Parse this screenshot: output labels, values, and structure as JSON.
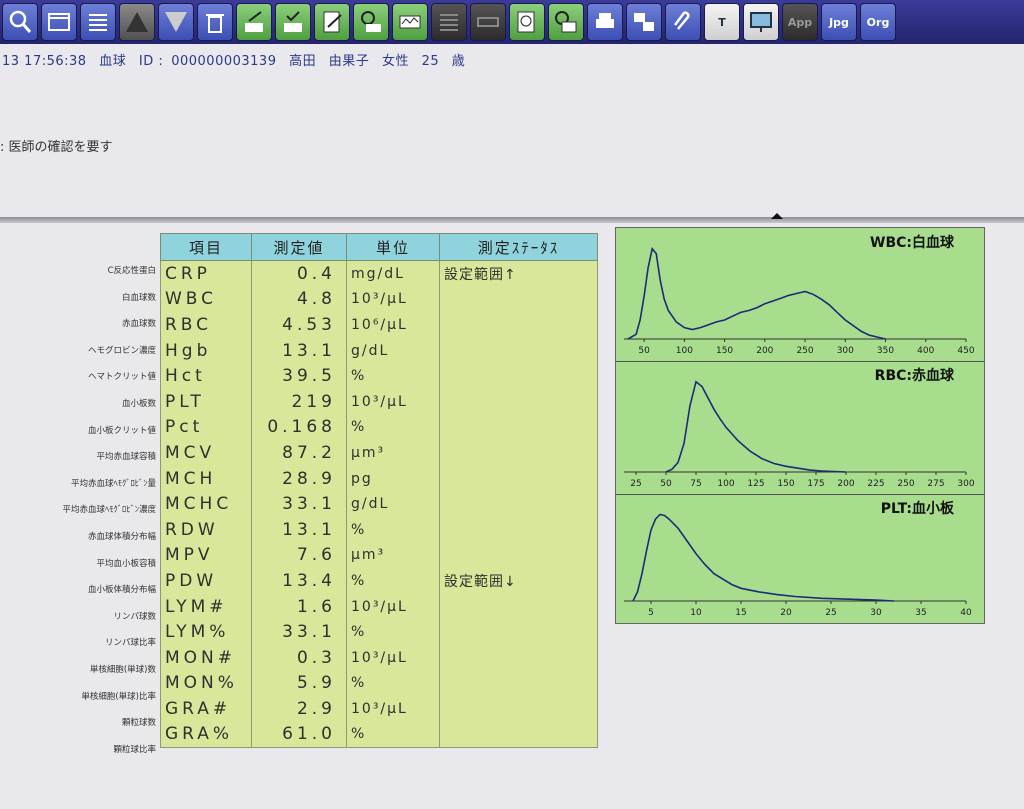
{
  "toolbar": {
    "buttons": [
      {
        "icon": "magnifier-icon",
        "style": "tb-blue"
      },
      {
        "icon": "screen-icon",
        "style": "tb-blue"
      },
      {
        "icon": "list-icon",
        "style": "tb-blue"
      },
      {
        "icon": "arrow-up-icon",
        "style": "tb-gray"
      },
      {
        "icon": "arrow-down-icon",
        "style": "tb-blue"
      },
      {
        "icon": "trash-icon",
        "style": "tb-blue"
      },
      {
        "icon": "pen-qr-icon",
        "style": "tb-green"
      },
      {
        "icon": "check-qr-icon",
        "style": "tb-green"
      },
      {
        "icon": "edit-doc-icon",
        "style": "tb-green"
      },
      {
        "icon": "clock-qr-icon",
        "style": "tb-green"
      },
      {
        "icon": "graph-icon",
        "style": "tb-green"
      },
      {
        "icon": "rows-icon",
        "style": "tb-dark"
      },
      {
        "icon": "ruler-icon",
        "style": "tb-dark"
      },
      {
        "icon": "clock-doc-icon",
        "style": "tb-green"
      },
      {
        "icon": "clock-chart-icon",
        "style": "tb-green"
      },
      {
        "icon": "printer-icon",
        "style": "tb-blue"
      },
      {
        "icon": "transfer-icon",
        "style": "tb-blue"
      },
      {
        "icon": "clip-icon",
        "style": "tb-blue"
      },
      {
        "icon": "text-icon",
        "style": "tb-white",
        "label": "T"
      },
      {
        "icon": "monitor-icon",
        "style": "tb-white"
      },
      {
        "icon": "app-icon",
        "style": "tb-dark",
        "label": "App"
      },
      {
        "icon": "jpg-icon",
        "style": "tb-blue",
        "label": "Jpg"
      },
      {
        "icon": "org-icon",
        "style": "tb-blue",
        "label": "Org"
      }
    ]
  },
  "patient": {
    "datetime": "13 17:56:38",
    "test_type": "血球",
    "id_label": "ID :",
    "id": "000000003139",
    "name_family": "高田",
    "name_given": "由果子",
    "sex": "女性",
    "age": "25",
    "age_unit": "歳"
  },
  "notice": ": 医師の確認を要す",
  "table": {
    "headers": [
      "項目",
      "測定値",
      "単位",
      "測定ｽﾃｰﾀｽ"
    ],
    "rows": [
      {
        "label": "C反応性蛋白",
        "item": "CRP",
        "value": "0.4",
        "unit": "mg/dL",
        "status": "設定範囲↑"
      },
      {
        "label": "白血球数",
        "item": "WBC",
        "value": "4.8",
        "unit": "10³/μL",
        "status": ""
      },
      {
        "label": "赤血球数",
        "item": "RBC",
        "value": "4.53",
        "unit": "10⁶/μL",
        "status": ""
      },
      {
        "label": "ヘモグロビン濃度",
        "item": "Hgb",
        "value": "13.1",
        "unit": "g/dL",
        "status": ""
      },
      {
        "label": "ヘマトクリット値",
        "item": "Hct",
        "value": "39.5",
        "unit": "%",
        "status": ""
      },
      {
        "label": "血小板数",
        "item": "PLT",
        "value": "219",
        "unit": "10³/μL",
        "status": ""
      },
      {
        "label": "血小板クリット値",
        "item": "Pct",
        "value": "0.168",
        "unit": "%",
        "status": ""
      },
      {
        "label": "平均赤血球容積",
        "item": "MCV",
        "value": "87.2",
        "unit": "μm³",
        "status": ""
      },
      {
        "label": "平均赤血球ﾍﾓｸﾞﾛﾋﾞﾝ量",
        "item": "MCH",
        "value": "28.9",
        "unit": "pg",
        "status": ""
      },
      {
        "label": "平均赤血球ﾍﾓｸﾞﾛﾋﾞﾝ濃度",
        "item": "MCHC",
        "value": "33.1",
        "unit": "g/dL",
        "status": ""
      },
      {
        "label": "赤血球体積分布幅",
        "item": "RDW",
        "value": "13.1",
        "unit": "%",
        "status": ""
      },
      {
        "label": "平均血小板容積",
        "item": "MPV",
        "value": "7.6",
        "unit": "μm³",
        "status": ""
      },
      {
        "label": "血小板体積分布幅",
        "item": "PDW",
        "value": "13.4",
        "unit": "%",
        "status": "設定範囲↓"
      },
      {
        "label": "リンパ球数",
        "item": "LYM#",
        "value": "1.6",
        "unit": "10³/μL",
        "status": ""
      },
      {
        "label": "リンパ球比率",
        "item": "LYM%",
        "value": "33.1",
        "unit": "%",
        "status": ""
      },
      {
        "label": "単核細胞(単球)数",
        "item": "MON#",
        "value": "0.3",
        "unit": "10³/μL",
        "status": ""
      },
      {
        "label": "単核細胞(単球)比率",
        "item": "MON%",
        "value": "5.9",
        "unit": "%",
        "status": ""
      },
      {
        "label": "顆粒球数",
        "item": "GRA#",
        "value": "2.9",
        "unit": "10³/μL",
        "status": ""
      },
      {
        "label": "顆粒球比率",
        "item": "GRA%",
        "value": "61.0",
        "unit": "%",
        "status": ""
      }
    ]
  },
  "chart_data": [
    {
      "type": "line",
      "title": "WBC:白血球",
      "xlim": [
        25,
        450
      ],
      "xticks": [
        50,
        100,
        150,
        200,
        250,
        300,
        350,
        400,
        450
      ],
      "x": [
        30,
        40,
        45,
        50,
        55,
        60,
        65,
        70,
        75,
        80,
        90,
        100,
        110,
        120,
        130,
        140,
        150,
        160,
        170,
        180,
        190,
        200,
        210,
        220,
        230,
        240,
        250,
        260,
        270,
        280,
        290,
        300,
        310,
        320,
        330,
        340,
        350
      ],
      "y": [
        0,
        0.05,
        0.2,
        0.45,
        0.75,
        0.95,
        0.9,
        0.62,
        0.42,
        0.3,
        0.18,
        0.12,
        0.1,
        0.12,
        0.15,
        0.18,
        0.2,
        0.24,
        0.28,
        0.3,
        0.33,
        0.37,
        0.4,
        0.43,
        0.46,
        0.48,
        0.5,
        0.47,
        0.42,
        0.36,
        0.28,
        0.2,
        0.14,
        0.08,
        0.04,
        0.02,
        0
      ]
    },
    {
      "type": "line",
      "title": "RBC:赤血球",
      "xlim": [
        15,
        300
      ],
      "xticks": [
        25,
        50,
        75,
        100,
        125,
        150,
        175,
        200,
        225,
        250,
        275,
        300
      ],
      "x": [
        50,
        55,
        60,
        65,
        70,
        75,
        80,
        85,
        90,
        95,
        100,
        110,
        120,
        130,
        140,
        150,
        160,
        170,
        180,
        190,
        200
      ],
      "y": [
        0,
        0.03,
        0.1,
        0.3,
        0.7,
        0.95,
        0.9,
        0.78,
        0.66,
        0.56,
        0.47,
        0.33,
        0.22,
        0.14,
        0.09,
        0.06,
        0.04,
        0.02,
        0.01,
        0.005,
        0
      ]
    },
    {
      "type": "line",
      "title": "PLT:血小板",
      "xlim": [
        2,
        40
      ],
      "xticks": [
        5,
        10,
        15,
        20,
        25,
        30,
        35,
        40
      ],
      "x": [
        3,
        3.5,
        4,
        4.5,
        5,
        5.5,
        6,
        6.5,
        7,
        8,
        9,
        10,
        11,
        12,
        13,
        14,
        15,
        17,
        19,
        21,
        24,
        27,
        30,
        32
      ],
      "y": [
        0,
        0.1,
        0.3,
        0.55,
        0.78,
        0.9,
        0.95,
        0.94,
        0.9,
        0.8,
        0.66,
        0.52,
        0.4,
        0.3,
        0.24,
        0.18,
        0.14,
        0.1,
        0.07,
        0.05,
        0.03,
        0.02,
        0.01,
        0
      ]
    }
  ]
}
